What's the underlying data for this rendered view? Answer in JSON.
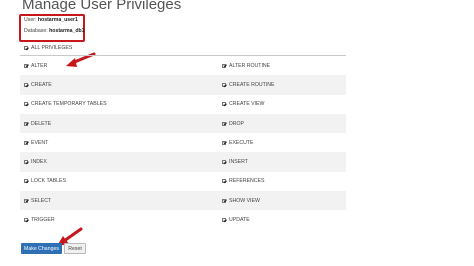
{
  "page": {
    "title": "Manage User Privileges"
  },
  "info": {
    "user_label": "User:",
    "user_value": "hostarma_user1",
    "database_label": "Database:",
    "database_value": "hostarma_db1"
  },
  "all_privileges": {
    "label": "ALL PRIVILEGES",
    "checked": true
  },
  "privileges": [
    {
      "left": "ALTER",
      "right": "ALTER ROUTINE"
    },
    {
      "left": "CREATE",
      "right": "CREATE ROUTINE"
    },
    {
      "left": "CREATE TEMPORARY TABLES",
      "right": "CREATE VIEW"
    },
    {
      "left": "DELETE",
      "right": "DROP"
    },
    {
      "left": "EVENT",
      "right": "EXECUTE"
    },
    {
      "left": "INDEX",
      "right": "INSERT"
    },
    {
      "left": "LOCK TABLES",
      "right": "REFERENCES"
    },
    {
      "left": "SELECT",
      "right": "SHOW VIEW"
    },
    {
      "left": "TRIGGER",
      "right": "UPDATE"
    }
  ],
  "buttons": {
    "make_changes": "Make Changes",
    "reset": "Reset"
  },
  "colors": {
    "highlight": "#c8161d",
    "primary_button": "#2e6fb5"
  }
}
